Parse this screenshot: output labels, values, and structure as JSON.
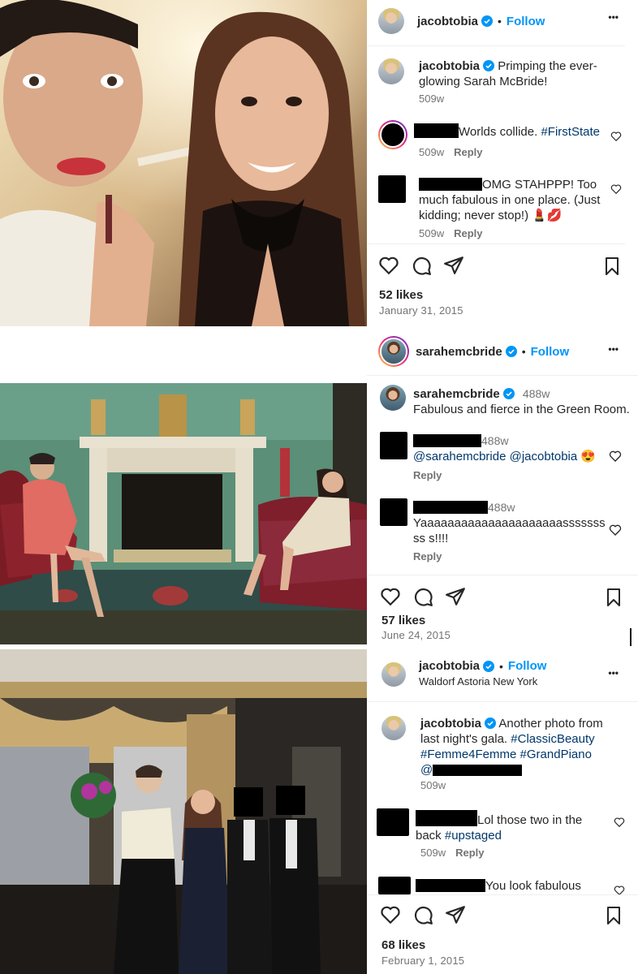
{
  "posts": [
    {
      "username": "jacobtobia",
      "follow": "Follow",
      "dot": "•",
      "more": "•••",
      "caption_user": "jacobtobia",
      "caption_text": "Primping the ever-glowing Sarah McBride!",
      "caption_time": "509w",
      "comments": [
        {
          "text": "Worlds collide. ",
          "tag": "#FirstState",
          "time": "509w",
          "reply": "Reply"
        },
        {
          "text": "OMG STAHPPP! Too much fabulous in one place. (Just kidding; never stop!) 💄💋",
          "time": "509w",
          "reply": "Reply"
        }
      ],
      "likes": "52 likes",
      "date": "January 31, 2015"
    },
    {
      "username": "sarahemcbride",
      "follow": "Follow",
      "dot": "•",
      "more": "•••",
      "caption_user": "sarahemcbride",
      "caption_time": "488w",
      "caption_text": "Fabulous and fierce in the Green Room.",
      "comments": [
        {
          "time": "488w",
          "text": "@sarahemcbride @jacobtobia 😍",
          "reply": "Reply"
        },
        {
          "time": "488w",
          "text": "Yaaaaaaaaaaaaaaaaaaaaasssssssss s!!!!",
          "reply": "Reply"
        }
      ],
      "likes": "57 likes",
      "date": "June 24, 2015"
    },
    {
      "username": "jacobtobia",
      "follow": "Follow",
      "dot": "•",
      "more": "•••",
      "location": "Waldorf Astoria New York",
      "caption_user": "jacobtobia",
      "caption_text_1": "Another photo from last night's gala. ",
      "caption_tag_1": "#ClassicBeauty",
      "caption_tag_2": "#Femme4Femme",
      "caption_tag_3": "#GrandPiano",
      "caption_at": "@",
      "caption_time": "509w",
      "comments": [
        {
          "text": "Lol those two in the back ",
          "tag": "#upstaged",
          "time": "509w",
          "reply": "Reply"
        },
        {
          "text": "You look fabulous"
        }
      ],
      "likes": "68 likes",
      "date": "February 1, 2015"
    }
  ],
  "icons": [
    "verified-badge-icon",
    "heart-icon",
    "comment-icon",
    "share-icon",
    "bookmark-icon",
    "more-icon"
  ],
  "colors": {
    "link": "#0095f6",
    "hashtag": "#00376b",
    "verified": "#0095f6",
    "meta": "#737373"
  }
}
